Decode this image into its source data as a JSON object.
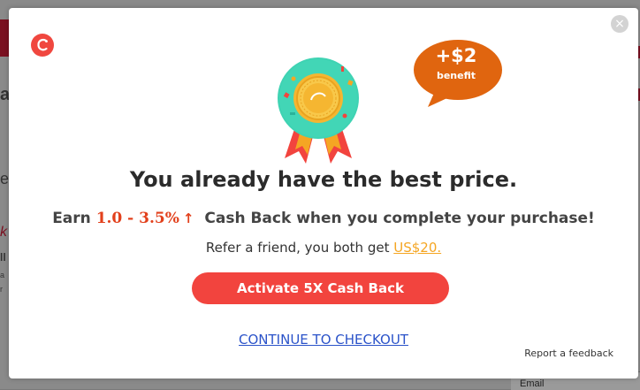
{
  "background": {
    "fragments": [
      "a",
      "e",
      "k",
      "ll",
      "a",
      "r"
    ],
    "email_label": "Email"
  },
  "modal": {
    "close_label": "×",
    "logo_icon": "brand-c-logo-icon",
    "benefit": {
      "amount": "+$2",
      "label": "benefit"
    },
    "medal_icon": "best-price-medal-icon",
    "headline": "You already have the best price.",
    "earn": {
      "prefix": "Earn",
      "rate": "1.0 - 3.5%",
      "arrow": "↑",
      "suffix": "Cash Back when you complete your purchase!"
    },
    "refer": {
      "text": "Refer a friend, you both get",
      "amount": "US$20."
    },
    "activate_label": "Activate 5X Cash Back",
    "continue_label": "CONTINUE TO CHECKOUT",
    "report_label": "Report a feedback"
  },
  "colors": {
    "primary": "#f2443e",
    "bubble": "#e0650f",
    "rate": "#e2401c",
    "link": "#2b53c9",
    "refer": "#f5a623"
  }
}
